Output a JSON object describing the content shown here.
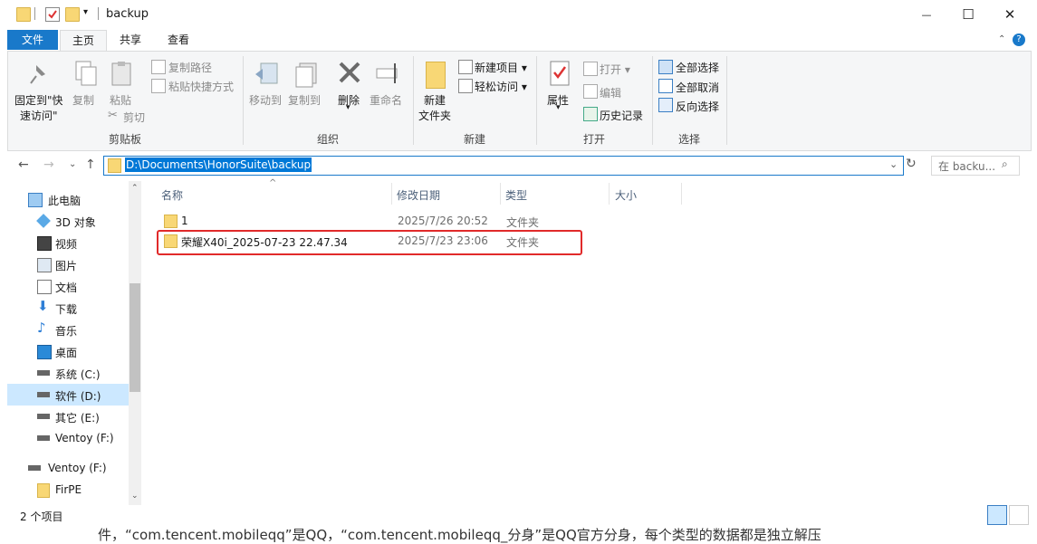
{
  "window": {
    "title": "backup",
    "minimize": "—",
    "maximize": "☐",
    "close": "✕"
  },
  "tabs": {
    "file": "文件",
    "home": "主页",
    "share": "共享",
    "view": "查看"
  },
  "ribbon": {
    "clipboard": {
      "label": "剪贴板",
      "pin": "固定到\"快",
      "pin2": "速访问\"",
      "copy": "复制",
      "paste": "粘贴",
      "copy_path": "复制路径",
      "paste_shortcut": "粘贴快捷方式",
      "cut": "剪切"
    },
    "organize": {
      "label": "组织",
      "move_to": "移动到",
      "copy_to": "复制到",
      "delete": "删除",
      "rename": "重命名"
    },
    "new": {
      "label": "新建",
      "new_folder": "新建",
      "new_folder2": "文件夹",
      "new_item": "新建项目",
      "easy_access": "轻松访问"
    },
    "open": {
      "label": "打开",
      "properties": "属性",
      "open": "打开",
      "edit": "编辑",
      "history": "历史记录"
    },
    "select": {
      "label": "选择",
      "select_all": "全部选择",
      "select_none": "全部取消",
      "invert": "反向选择"
    }
  },
  "address": {
    "path": "D:\\Documents\\HonorSuite\\backup",
    "search_placeholder": "在 backu..."
  },
  "nav": [
    {
      "label": "此电脑"
    },
    {
      "label": "3D 对象"
    },
    {
      "label": "视频"
    },
    {
      "label": "图片"
    },
    {
      "label": "文档"
    },
    {
      "label": "下载"
    },
    {
      "label": "音乐"
    },
    {
      "label": "桌面"
    },
    {
      "label": "系统 (C:)"
    },
    {
      "label": "软件 (D:)"
    },
    {
      "label": "其它 (E:)"
    },
    {
      "label": "Ventoy (F:)"
    },
    {
      "label": "Ventoy (F:)"
    },
    {
      "label": "FirPE"
    }
  ],
  "columns": {
    "name": "名称",
    "modified": "修改日期",
    "type": "类型",
    "size": "大小"
  },
  "files": [
    {
      "name": "1",
      "modified": "2025/7/26 20:52",
      "type": "文件夹"
    },
    {
      "name": "荣耀X40i_2025-07-23 22.47.34",
      "modified": "2025/7/23 23:06",
      "type": "文件夹"
    }
  ],
  "status": {
    "count": "2 个项目"
  },
  "background_text": "件，“com.tencent.mobileqq”是QQ，“com.tencent.mobileqq_分身”是QQ官方分身，每个类型的数据都是独立解压"
}
